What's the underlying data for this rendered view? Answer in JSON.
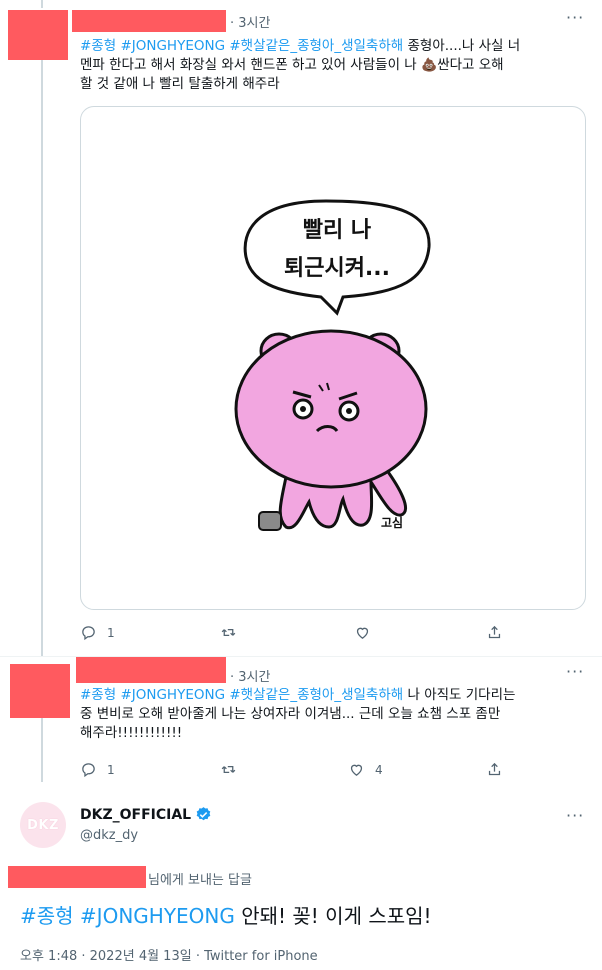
{
  "tweets": [
    {
      "time": "3시간",
      "hashtags": [
        "#종형",
        "#JONGHYEONG",
        "#햇살같은_종형아_생일축하해"
      ],
      "line1_text": " 종형아....나 사실 너",
      "line2_text": "멘파 한다고 해서 화장실 와서 핸드폰 하고 있어 사람들이 나 ",
      "emoji": "💩",
      "line2_after": "싼다고 오해",
      "line3_text": "할 것 같애 나 빨리 탈출하게 해주라",
      "reply_count": "1",
      "like_count": ""
    },
    {
      "time": "3시간",
      "hashtags": [
        "#종형",
        "#JONGHYEONG",
        "#햇살같은_종형아_생일축하해"
      ],
      "line1_text": " 나 아직도 기다리는",
      "line2_text": "중 변비로 오해 받아줄게 나는 상여자라 이겨냄... 근데 오늘 쇼챔 스포 좀만",
      "line3_text": "해주라!!!!!!!!!!!!",
      "reply_count": "1",
      "like_count": "4"
    }
  ],
  "image_text": {
    "bubble_line1": "빨리 나",
    "bubble_line2": "퇴근시켜...",
    "signature": "고심"
  },
  "main_tweet": {
    "avatar_text": "DKZ",
    "display_name": "DKZ_OFFICIAL",
    "handle": "@dkz_dy",
    "reply_to_suffix": "님에게 보내는 답글",
    "hashtag1": "#종형",
    "hashtag2": "#JONGHYEONG",
    "text": " 안돼! 꽂! 이게 스포임!",
    "timestamp": "오후 1:48 · 2022년 4월 13일 · Twitter for iPhone"
  },
  "colors": {
    "accent": "#1d9bf0",
    "redaction": "#ff5a5f",
    "verified": "#1d9bf0",
    "character_pink": "#f2a6e0"
  }
}
